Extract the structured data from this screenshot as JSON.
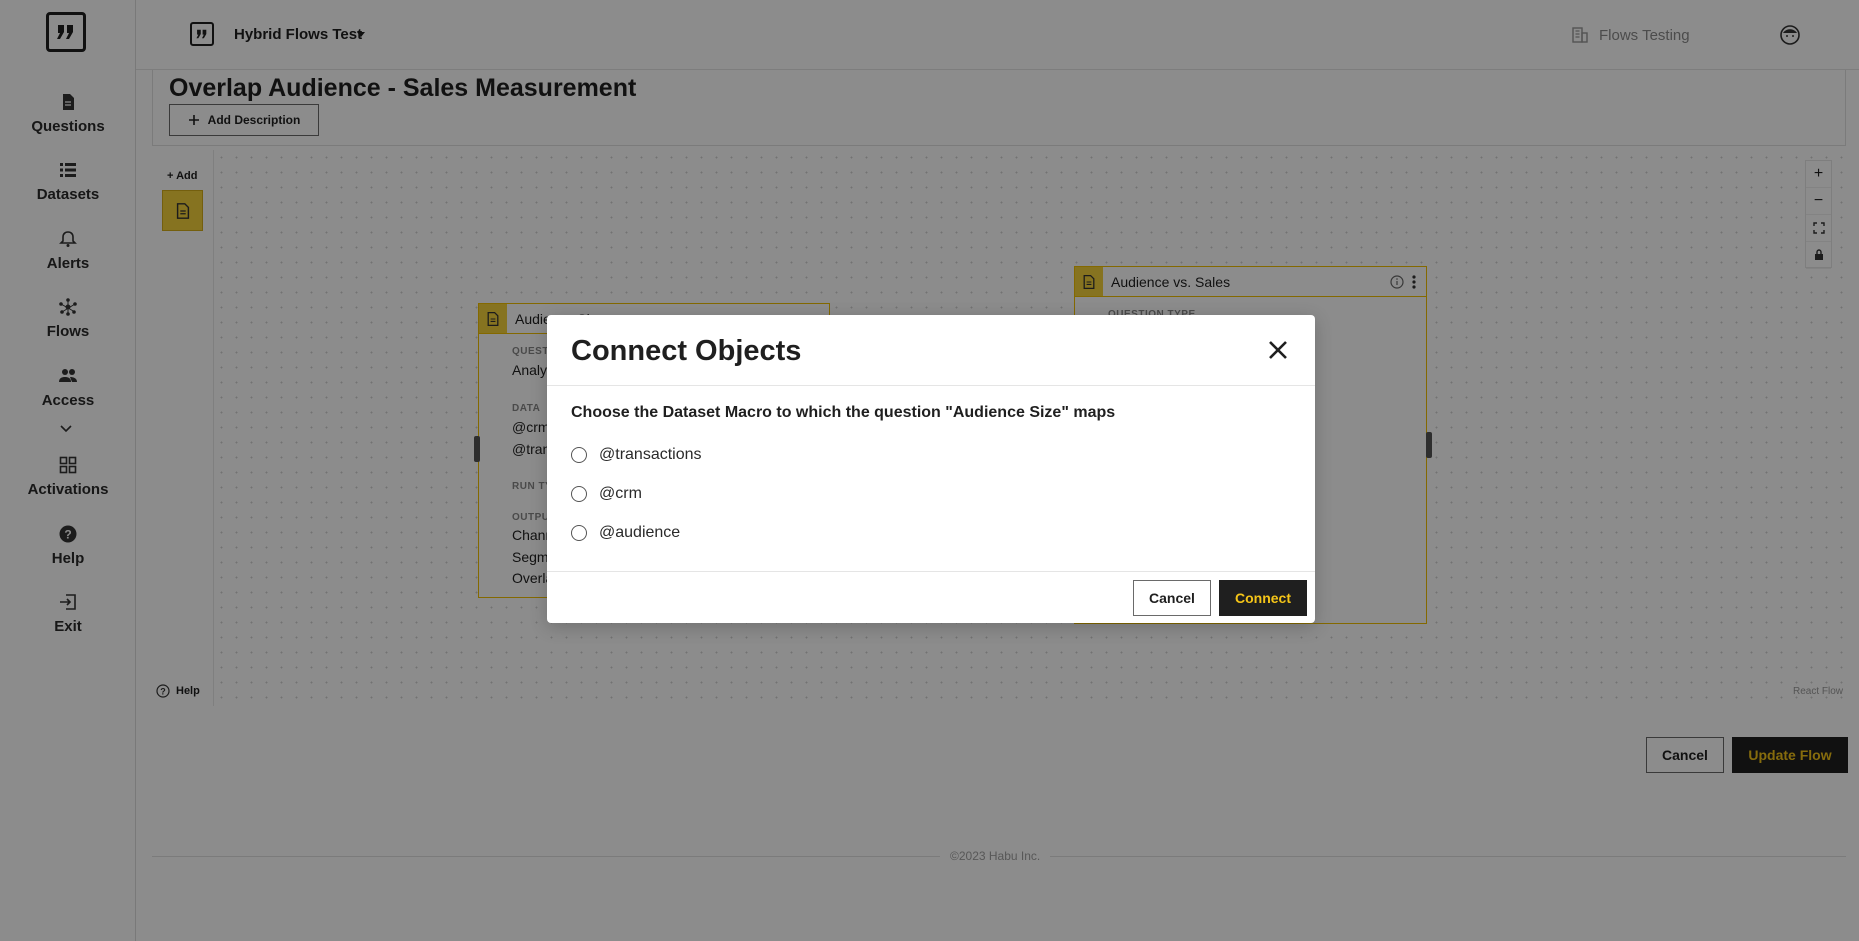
{
  "org": {
    "name": "Hybrid Flows Test"
  },
  "workspace": {
    "name": "Flows Testing"
  },
  "sidebar": {
    "items": [
      {
        "label": "Questions",
        "icon": "document-icon"
      },
      {
        "label": "Datasets",
        "icon": "list-icon"
      },
      {
        "label": "Alerts",
        "icon": "bell-icon"
      },
      {
        "label": "Flows",
        "icon": "flows-icon"
      },
      {
        "label": "Access",
        "icon": "people-icon"
      },
      {
        "label": "Activations",
        "icon": "grid-icon"
      },
      {
        "label": "Help",
        "icon": "help-icon"
      },
      {
        "label": "Exit",
        "icon": "exit-icon"
      }
    ]
  },
  "page": {
    "title": "Overlap Audience - Sales Measurement",
    "add_description_label": "Add Description"
  },
  "canvas": {
    "add_label": "+ Add",
    "help_label": "Help",
    "attribution": "React Flow",
    "nodes": [
      {
        "title": "Audience Size",
        "rows": [
          {
            "kind": "small",
            "text": "QUESTION TYPE"
          },
          {
            "kind": "text",
            "text": "Analytical"
          },
          {
            "kind": "small",
            "text": "DATA"
          },
          {
            "kind": "text",
            "text": "@crm"
          },
          {
            "kind": "text",
            "text": "@transactions"
          },
          {
            "kind": "small",
            "text": "RUN TYPE"
          },
          {
            "kind": "small",
            "text": "OUTPUT"
          },
          {
            "kind": "text",
            "text": "Channel"
          },
          {
            "kind": "text",
            "text": "Segment"
          },
          {
            "kind": "text",
            "text": "Overlap"
          }
        ]
      },
      {
        "title": "Audience vs. Sales",
        "rows": [
          {
            "kind": "small",
            "text": "QUESTION TYPE"
          }
        ]
      }
    ]
  },
  "actions": {
    "cancel_label": "Cancel",
    "update_label": "Update Flow"
  },
  "footer": {
    "text": "©2023 Habu Inc."
  },
  "modal": {
    "title": "Connect Objects",
    "question": "Choose the Dataset Macro to which the question \"Audience Size\" maps",
    "options": [
      "@transactions",
      "@crm",
      "@audience"
    ],
    "cancel_label": "Cancel",
    "connect_label": "Connect"
  }
}
